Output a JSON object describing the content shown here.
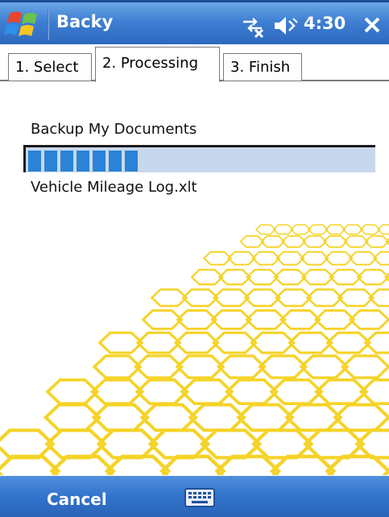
{
  "titlebar": {
    "app_title": "Backy",
    "time": "4:30",
    "icons": [
      "windows-start-icon",
      "connectivity-off-icon",
      "volume-muted-icon",
      "close-icon"
    ]
  },
  "tabs": [
    {
      "label": "1. Select",
      "active": false
    },
    {
      "label": "2. Processing",
      "active": true
    },
    {
      "label": "3. Finish",
      "active": false
    }
  ],
  "content": {
    "job_label": "Backup My Documents",
    "progress_fraction": 0.35,
    "current_file": "Vehicle Mileage Log.xlt"
  },
  "menubar": {
    "left_label": "Cancel",
    "input_icon": "keyboard-icon"
  },
  "colors": {
    "title_bar": "#3f7fd3",
    "menu_bar": "#3273cc",
    "progress_fill": "#2a83d6",
    "progress_track": "#c7d8ec",
    "honeycomb": "#f5d328"
  }
}
